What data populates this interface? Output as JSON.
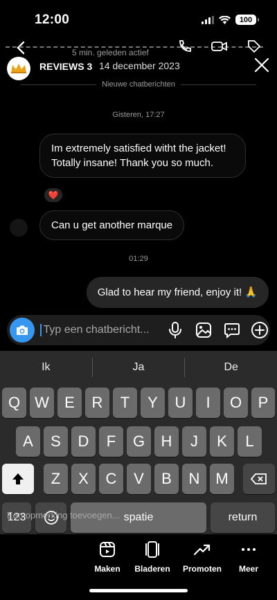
{
  "status": {
    "time": "12:00",
    "battery": "100"
  },
  "header": {
    "active_status": "5 min. geleden actief",
    "name": "REVIEWS 3",
    "date": "14 december 2023"
  },
  "thread": {
    "new_messages_divider": "Nieuwe chatberichten",
    "timestamp_1": "Gisteren, 17:27",
    "message_1": "Im extremely satisfied witht the jacket! Totally insane! Thank you so much.",
    "reaction_1": "❤️",
    "message_2": "Can u get another marque",
    "timestamp_2": "01:29",
    "message_3": "Glad to hear my friend, enjoy it! 🙏"
  },
  "composer": {
    "placeholder": "Typ een chatbericht..."
  },
  "keyboard": {
    "suggestions": [
      "Ik",
      "Ja",
      "De"
    ],
    "row1": [
      "Q",
      "W",
      "E",
      "R",
      "T",
      "Y",
      "U",
      "I",
      "O",
      "P"
    ],
    "row2": [
      "A",
      "S",
      "D",
      "F",
      "G",
      "H",
      "J",
      "K",
      "L"
    ],
    "row3": [
      "Z",
      "X",
      "C",
      "V",
      "B",
      "N",
      "M"
    ],
    "numbers_key": "123",
    "space_key": "spatie",
    "return_key": "return",
    "overlay_hint": "Een opmerking toevoegen..."
  },
  "bottom_nav": [
    {
      "label": "Maken",
      "icon": "reels-icon"
    },
    {
      "label": "Bladeren",
      "icon": "cards-icon"
    },
    {
      "label": "Promoten",
      "icon": "trend-icon"
    },
    {
      "label": "Meer",
      "icon": "more-icon"
    }
  ],
  "colors": {
    "accent": "#3797f0",
    "background": "#000000",
    "bubble_sent": "#262626"
  }
}
